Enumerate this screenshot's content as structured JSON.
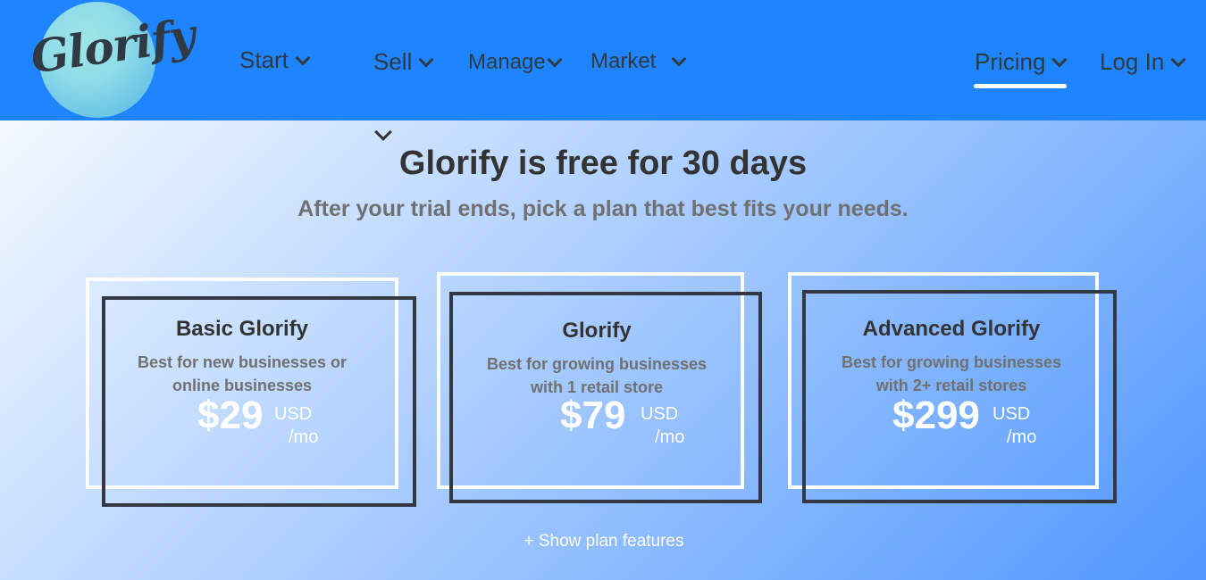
{
  "brand": {
    "logo_text": "Glorify"
  },
  "nav": {
    "start": "Start",
    "sell": "Sell",
    "manage": "Manage",
    "market": "Market",
    "pricing": "Pricing",
    "login": "Log In"
  },
  "hero": {
    "title": "Glorify is free for 30 days",
    "subtitle": "After your trial ends, pick a plan that best fits your needs."
  },
  "plans": [
    {
      "name": "Basic Glorify",
      "desc_line1": "Best for new businesses or",
      "desc_line2": "online businesses",
      "price": "$29",
      "currency": "USD",
      "period": "/mo"
    },
    {
      "name": "Glorify",
      "desc_line1": "Best for growing businesses",
      "desc_line2": "with 1 retail store",
      "price": "$79",
      "currency": "USD",
      "period": "/mo"
    },
    {
      "name": "Advanced Glorify",
      "desc_line1": "Best for growing businesses",
      "desc_line2": "with 2+ retail stores",
      "price": "$299",
      "currency": "USD",
      "period": "/mo"
    }
  ],
  "footer": {
    "show_features": "+ Show plan features"
  },
  "colors": {
    "topbar": "#1e84ff",
    "text_dark": "#333333",
    "text_muted": "#707070",
    "frame_dark": "#333842"
  }
}
